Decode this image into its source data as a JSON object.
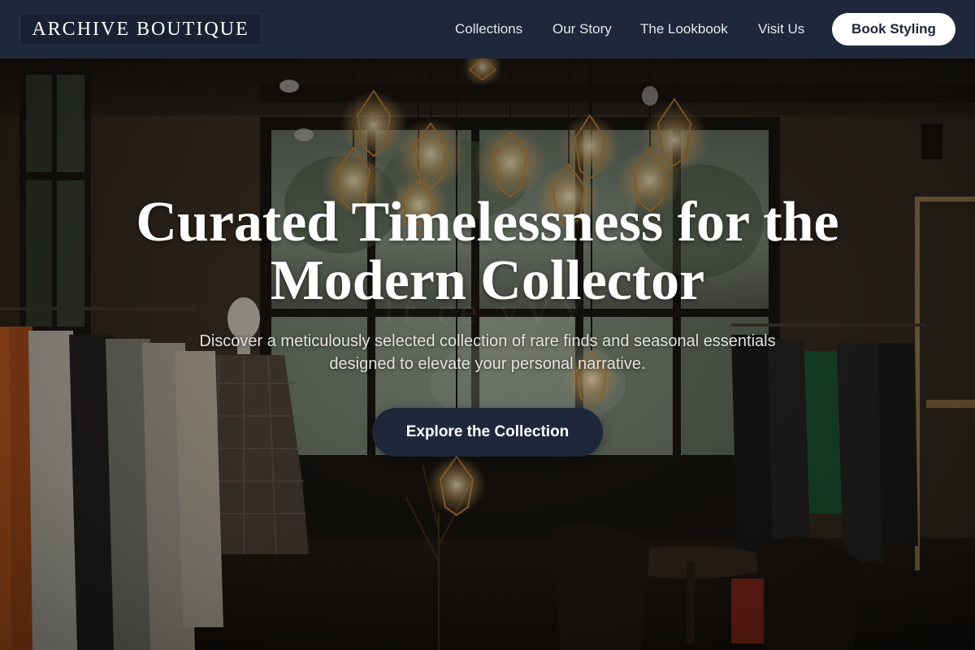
{
  "brand": {
    "name": "ARCHIVE BOUTIQUE"
  },
  "nav": {
    "links": [
      "Collections",
      "Our Story",
      "The Lookbook",
      "Visit Us"
    ],
    "cta_label": "Book Styling"
  },
  "hero": {
    "title_line1": "Curated Timelessness for the",
    "title_line2": "Modern Collector",
    "subtitle_line1": "Discover a meticulously selected collection of rare finds and seasonal essentials",
    "subtitle_line2": "designed to elevate your personal narrative.",
    "cta_label": "Explore the Collection",
    "background": "boutique-interior-photo"
  },
  "colors": {
    "nav_background": "#1f283a",
    "primary_button": "#1f283a",
    "secondary_button": "#ffffff",
    "text_light": "#ffffff"
  }
}
